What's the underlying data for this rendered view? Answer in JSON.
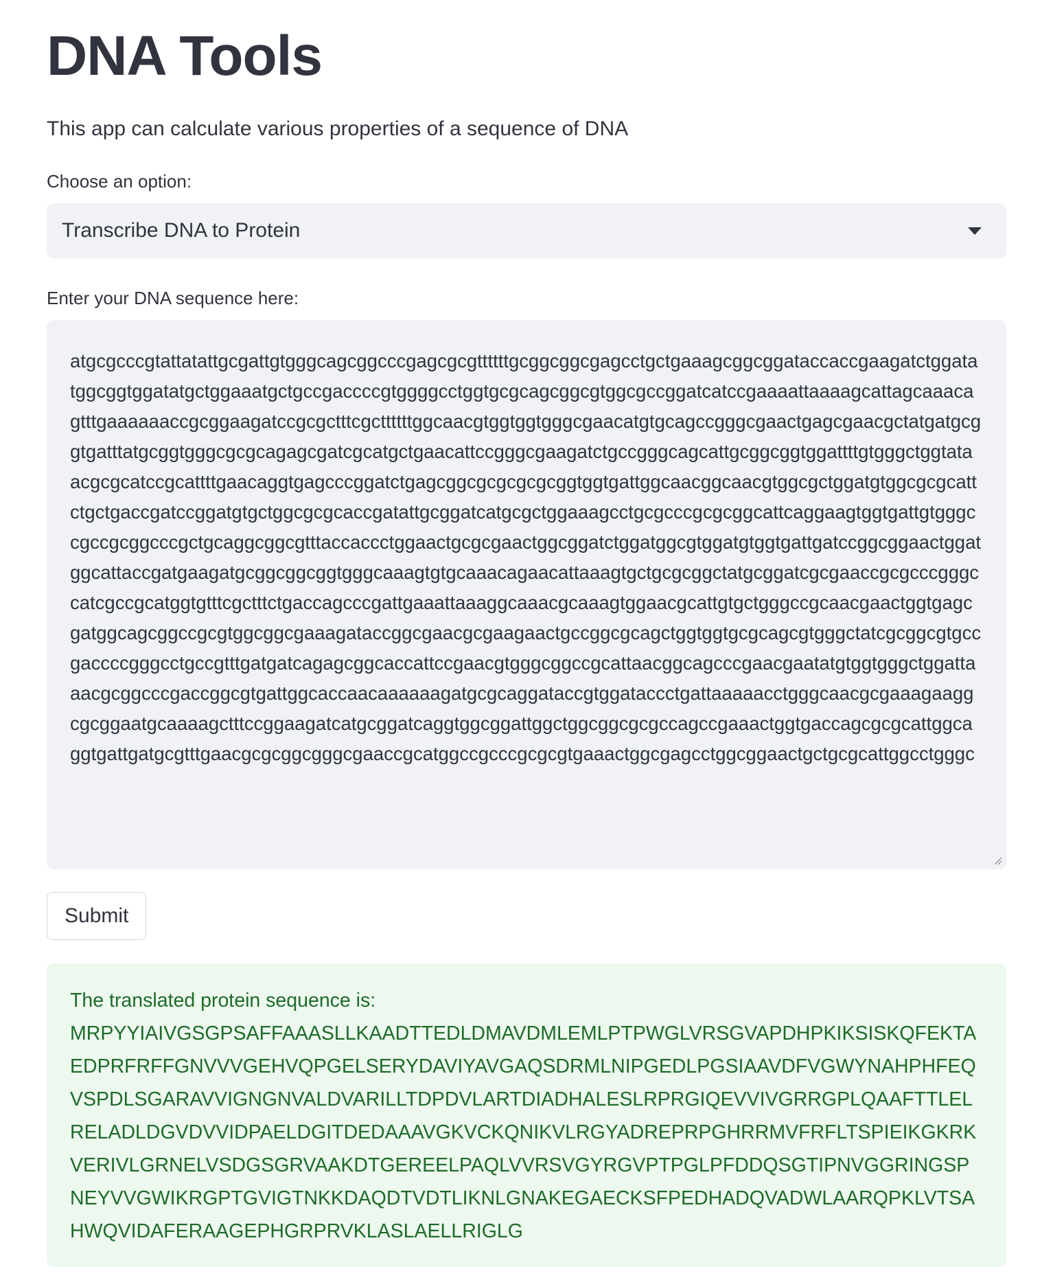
{
  "header": {
    "title": "DNA Tools",
    "subtitle": "This app can calculate various properties of a sequence of DNA"
  },
  "option_select": {
    "label": "Choose an option:",
    "selected": "Transcribe DNA to Protein"
  },
  "dna_input": {
    "label": "Enter your DNA sequence here:",
    "value": "atgcgcccgtattatattgcgattgtgggcagcggcccgagcgcgttttttgcggcggcgagcctgctgaaagcggcggataccaccgaagatctggatatggcggtggatatgctggaaatgctgccgaccccgtggggcctggtgcgcagcggcgtggcgccggatcatccgaaaattaaaagcattagcaaacagtttgaaaaaaccgcggaagatccgcgctttcgcttttttggcaacgtggtggtgggcgaacatgtgcagccgggcgaactgagcgaacgctatgatgcggtgatttatgcggtgggcgcgcagagcgatcgcatgctgaacattccgggcgaagatctgccgggcagcattgcggcggtggattttgtgggctggtataacgcgcatccgcattttgaacaggtgagcccggatctgagcggcgcgcgcgcggtggtgattggcaacggcaacgtggcgctggatgtggcgcgcattctgctgaccgatccggatgtgctggcgcgcaccgatattgcggatcatgcgctggaaagcctgcgcccgcgcggcattcaggaagtggtgattgtgggccgccgcggcccgctgcaggcggcgtttaccaccctggaactgcgcgaactggcggatctggatggcgtggatgtggtgattgatccggcggaactggatggcattaccgatgaagatgcggcggcggtgggcaaagtgtgcaaacagaacattaaagtgctgcgcggctatgcggatcgcgaaccgcgcccgggccatcgccgcatggtgtttcgctttctgaccagcccgattgaaattaaaggcaaacgcaaagtggaacgcattgtgctgggccgcaacgaactggtgagcgatggcagcggccgcgtggcggcgaaagataccggcgaacgcgaagaactgccggcgcagctggtggtgcgcagcgtgggctatcgcggcgtgccgaccccgggcctgccgtttgatgatcagagcggcaccattccgaacgtgggcggccgcattaacggcagcccgaacgaatatgtggtgggctggattaaacgcggcccgaccggcgtgattggcaccaacaaaaaagatgcgcaggataccgtggataccctgattaaaaacctgggcaacgcgaaagaaggcgcggaatgcaaaagctttccggaagatcatgcggatcaggtggcggattggctggcggcgcgccagccgaaactggtgaccagcgcgcattggcaggtgattgatgcgtttgaacgcgcggcgggcgaaccgcatggccgcccgcgcgtgaaactggcgagcctggcggaactgctgcgcattggcctgggc"
  },
  "submit": {
    "label": "Submit"
  },
  "result": {
    "heading": "The translated protein sequence is:",
    "sequence": "MRPYYIAIVGSGPSAFFAAASLLKAADTTEDLDMAVDMLEMLPTPWGLVRSGVAPDHPKIKSISKQFEKTAEDPRFRFFGNVVVGEHVQPGELSERYDAVIYAVGAQSDRMLNIPGEDLPGSIAAVDFVGWYNAHPHFEQVSPDLSGARAVVIGNGNVALDVARILLTDPDVLARTDIADHALESLRPRGIQEVVIVGRRGPLQAAFTTLELRELADLDGVDVVIDPAELDGITDEDAAAVGKVCKQNIKVLRGYADREPRPGHRRMVFRFLTSPIEIKGKRKVERIVLGRNELVSDGSGRVAAKDTGEREELPAQLVVRSVGYRGVPTPGLPFDDQSGTIPNVGGRINGSPNEYVVGWIKRGPTGVIGTNKKDAQDTVDTLIKNLGNAKEGAECKSFPEDHADQVADWLAARQPKLVTSAHWQVIDAFERAAGEPHGRPRVKLASLAELLRIGLG"
  },
  "icons": {
    "select_caret": "chevron-down-icon",
    "textarea_resize": "resize-handle-icon"
  },
  "colors": {
    "text": "#31333f",
    "input_bg": "#f0f2f6",
    "success_bg": "#edf8ee",
    "success_text": "#1e6b2a"
  }
}
